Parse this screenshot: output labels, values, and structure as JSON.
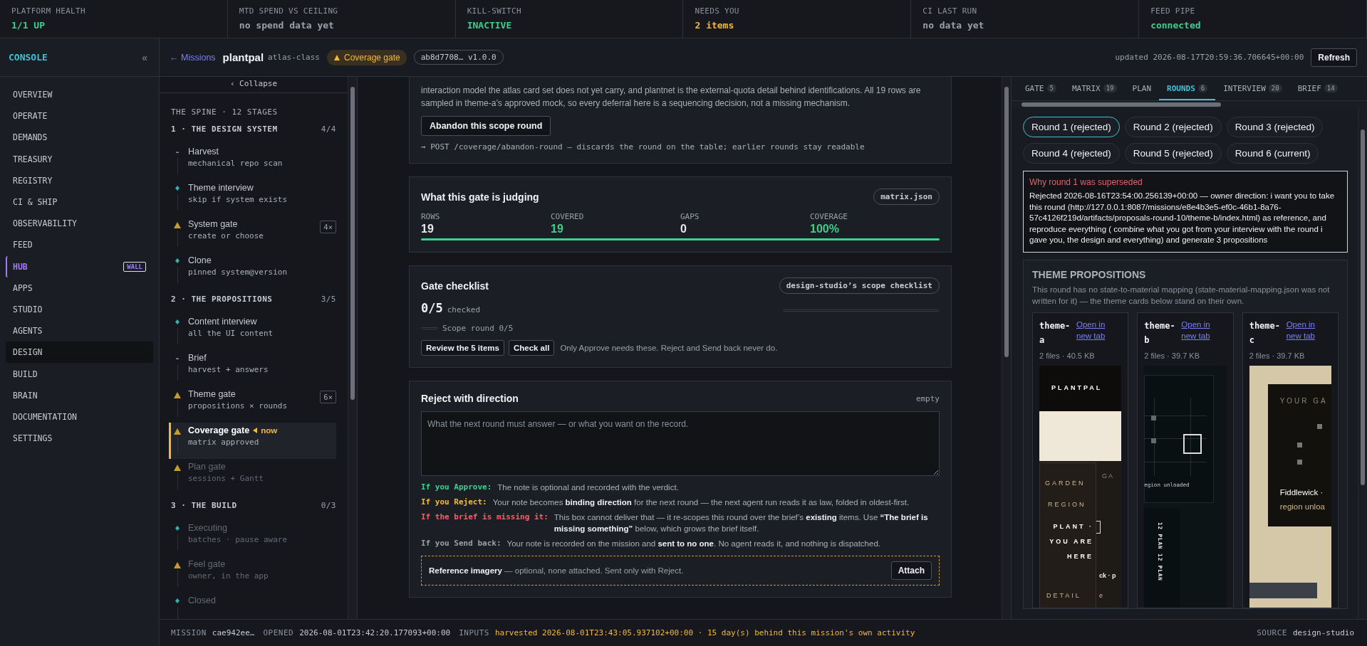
{
  "status_tiles": [
    {
      "label": "PLATFORM HEALTH",
      "value": "1/1 UP",
      "color": "#3ecf8e"
    },
    {
      "label": "MTD SPEND VS CEILING",
      "value": "no spend data yet",
      "color": "#9aa0a8"
    },
    {
      "label": "KILL-SWITCH",
      "value": "INACTIVE",
      "color": "#3ecf8e"
    },
    {
      "label": "NEEDS YOU",
      "value": "2 items",
      "color": "#f5b83d"
    },
    {
      "label": "CI LAST RUN",
      "value": "no data yet",
      "color": "#9aa0a8"
    },
    {
      "label": "FEED PIPE",
      "value": "connected",
      "color": "#3ecf8e"
    }
  ],
  "sidebar": {
    "brand": "CONSOLE",
    "collapse": "«",
    "items": [
      {
        "label": "OVERVIEW",
        "selected": false,
        "highlighted": false
      },
      {
        "label": "OPERATE",
        "selected": false,
        "highlighted": false
      },
      {
        "label": "DEMANDS",
        "selected": false,
        "highlighted": false
      },
      {
        "label": "TREASURY",
        "selected": false,
        "highlighted": false
      },
      {
        "label": "REGISTRY",
        "selected": false,
        "highlighted": false
      },
      {
        "label": "CI & SHIP",
        "selected": false,
        "highlighted": false
      },
      {
        "label": "OBSERVABILITY",
        "selected": false,
        "highlighted": false
      },
      {
        "label": "FEED",
        "selected": false,
        "highlighted": false
      },
      {
        "label": "HUB",
        "selected": false,
        "highlighted": true,
        "badge": "WALL"
      },
      {
        "label": "APPS",
        "selected": false,
        "highlighted": false
      },
      {
        "label": "STUDIO",
        "selected": false,
        "highlighted": false
      },
      {
        "label": "AGENTS",
        "selected": false,
        "highlighted": false
      },
      {
        "label": "DESIGN",
        "selected": true,
        "highlighted": false
      },
      {
        "label": "BUILD",
        "selected": false,
        "highlighted": false
      },
      {
        "label": "BRAIN",
        "selected": false,
        "highlighted": false
      },
      {
        "label": "DOCUMENTATION",
        "selected": false,
        "highlighted": false
      },
      {
        "label": "SETTINGS",
        "selected": false,
        "highlighted": false
      }
    ]
  },
  "header": {
    "back_link": "← Missions",
    "project": "plantpal",
    "project_class": "atlas-class",
    "gate_badge": "Coverage gate",
    "version_chip": "ab8d7708… v1.0.0",
    "updated": "updated 2026-08-17T20:59:36.706645+00:00",
    "refresh": "Refresh"
  },
  "spine": {
    "collapse": "‹ Collapse",
    "title": "THE SPINE · 12 STAGES",
    "groups": [
      {
        "title": "1 · THE DESIGN SYSTEM",
        "count": "4/4",
        "stages": [
          {
            "kind": "task",
            "name": "Harvest",
            "detail": "mechanical repo scan",
            "current": false,
            "disabled": false
          },
          {
            "kind": "agent",
            "name": "Theme interview",
            "detail": "skip if system exists",
            "current": false,
            "disabled": false
          },
          {
            "kind": "gate",
            "name": "System gate",
            "detail": "create or choose",
            "current": false,
            "disabled": false,
            "rounds": "4×"
          },
          {
            "kind": "agent",
            "name": "Clone",
            "detail": "pinned system@version",
            "current": false,
            "disabled": false
          }
        ]
      },
      {
        "title": "2 · THE PROPOSITIONS",
        "count": "3/5",
        "stages": [
          {
            "kind": "agent",
            "name": "Content interview",
            "detail": "all the UI content",
            "current": false,
            "disabled": false
          },
          {
            "kind": "task",
            "name": "Brief",
            "detail": "harvest + answers",
            "current": false,
            "disabled": false
          },
          {
            "kind": "gate",
            "name": "Theme gate",
            "detail": "propositions × rounds",
            "current": false,
            "disabled": false,
            "rounds": "6×"
          },
          {
            "kind": "gate",
            "name": "Coverage gate",
            "detail": "matrix approved",
            "current": true,
            "disabled": false,
            "now_label": "now"
          },
          {
            "kind": "gate",
            "name": "Plan gate",
            "detail": "sessions + Gantt",
            "current": false,
            "disabled": true
          }
        ]
      },
      {
        "title": "3 · THE BUILD",
        "count": "0/3",
        "stages": [
          {
            "kind": "agent",
            "name": "Executing",
            "detail": "batches · pause aware",
            "current": false,
            "disabled": true
          },
          {
            "kind": "gate",
            "name": "Feel gate",
            "detail": "owner, in the app",
            "current": false,
            "disabled": true
          },
          {
            "kind": "agent",
            "name": "Closed",
            "current": false,
            "disabled": true
          }
        ]
      }
    ]
  },
  "scope_card": {
    "paragraph": "interaction model the atlas card set does not yet carry, and plantnet is the external-quota detail behind identifications. All 19 rows are sampled in theme-a’s approved mock, so every deferral here is a sequencing decision, not a missing mechanism.",
    "button": "Abandon this scope round",
    "endpoint_note": "→ POST /coverage/abandon-round — discards the round on the table; earlier rounds stay readable"
  },
  "judging": {
    "title": "What this gate is judging",
    "chip": "matrix.json",
    "stats": [
      {
        "label": "ROWS",
        "value": "19",
        "color": "#e6e8eb"
      },
      {
        "label": "COVERED",
        "value": "19",
        "color": "#3ecf8e"
      },
      {
        "label": "GAPS",
        "value": "0",
        "color": "#e6e8eb"
      },
      {
        "label": "COVERAGE",
        "value": "100%",
        "color": "#3ecf8e"
      }
    ],
    "level": 1
  },
  "checklist": {
    "title": "Gate checklist",
    "chip": "design-studio’s scope checklist",
    "score": "0/5",
    "score_label": "checked",
    "level": 0,
    "scope_round": {
      "label": "Scope round 0/5",
      "level": 0
    },
    "buttons": [
      "Review the 5 items",
      "Check all"
    ],
    "note": "Only Approve needs these. Reject and Send back never do."
  },
  "reject": {
    "title": "Reject with direction",
    "status": "empty",
    "placeholder": "What the next round must answer — or what you want on the record.",
    "rules": [
      {
        "label": "If you Approve:",
        "color": "#3ecf8e",
        "text": "The note is optional and recorded with the verdict."
      },
      {
        "label": "If you Reject:",
        "color": "#f5b83d",
        "text": "Your note becomes **binding direction** for the next round — the next agent run reads it as law, folded in oldest-first."
      },
      {
        "label": "If the brief is missing it:",
        "color": "#f0606a",
        "text": "This box cannot deliver that — it re-scopes this round over the brief’s **existing** items. Use **“The brief is missing something”** below, which grows the brief itself."
      },
      {
        "label": "If you Send back:",
        "color": "#9aa0a8",
        "text": "Your note is recorded on the mission and **sent to no one**. No agent reads it, and nothing is dispatched."
      }
    ],
    "imagery": "**Reference imagery** — optional, none attached. Sent only with Reject.",
    "attach": "Attach"
  },
  "tabs": [
    {
      "label": "GATE",
      "count": "5",
      "selected": false
    },
    {
      "label": "MATRIX",
      "count": "19",
      "selected": false
    },
    {
      "label": "PLAN",
      "selected": false
    },
    {
      "label": "ROUNDS",
      "count": "6",
      "selected": true
    },
    {
      "label": "INTERVIEW",
      "count": "20",
      "selected": false
    },
    {
      "label": "BRIEF",
      "count": "14",
      "selected": false
    }
  ],
  "rounds": [
    {
      "label": "Round 1 (rejected)",
      "selected": true
    },
    {
      "label": "Round 2 (rejected)",
      "selected": false
    },
    {
      "label": "Round 3 (rejected)",
      "selected": false
    },
    {
      "label": "Round 4 (rejected)",
      "selected": false
    },
    {
      "label": "Round 5 (rejected)",
      "selected": false
    },
    {
      "label": "Round 6 (current)",
      "selected": false
    }
  ],
  "reason": {
    "title": "Why round 1 was superseded",
    "body": "Rejected 2026-08-16T23:54:00.256139+00:00 — owner direction: i want you to take this round (http://127.0.0.1:8087/missions/e8e4b3e5-ef0c-46b1-8a76-57c4126f219d/artifacts/proposals-round-10/theme-b/index.html) as reference, and reproduce everything ( combine what you got from your interview with the round i gave you, the design and everything) and generate 3 propositions"
  },
  "propositions": {
    "title": "THEME PROPOSITIONS",
    "note": "This round has no state-to-material mapping (state-material-mapping.json was not written for it) — the theme cards below stand on their own.",
    "themes": [
      {
        "name": "theme-a",
        "link": "Open in new tab",
        "meta": "2 files · 40.5 KB",
        "preview": {
          "kind": "a",
          "texts": [
            "PLANTPAL",
            "GA",
            "GARDEN",
            "REGION",
            "PLANT · YOU ARE HERE",
            "ck · p",
            "DETAIL",
            "e"
          ]
        }
      },
      {
        "name": "theme-b",
        "link": "Open in new tab",
        "meta": "2 files · 39.7 KB",
        "preview": {
          "kind": "b",
          "texts": [
            "egion unloaded",
            "12 PLAN 12 PLAN"
          ]
        }
      },
      {
        "name": "theme-c",
        "link": "Open in new tab",
        "meta": "2 files · 39.7 KB",
        "preview": {
          "kind": "c",
          "texts": [
            "YOUR GA",
            "Fiddlewick ·",
            "region unloa"
          ]
        }
      }
    ]
  },
  "footer": {
    "items": [
      {
        "label": "MISSION",
        "value": "cae942ee…",
        "color": "#c7cbd1"
      },
      {
        "label": "OPENED",
        "value": "2026-08-01T23:42:20.177093+00:00",
        "color": "#c7cbd1"
      },
      {
        "label": "INPUTS",
        "value": "harvested 2026-08-01T23:43:05.937102+00:00 · 15 day(s) behind this mission's own activity",
        "color": "#f5b83d"
      }
    ],
    "source_label": "SOURCE",
    "source": "design-studio"
  }
}
